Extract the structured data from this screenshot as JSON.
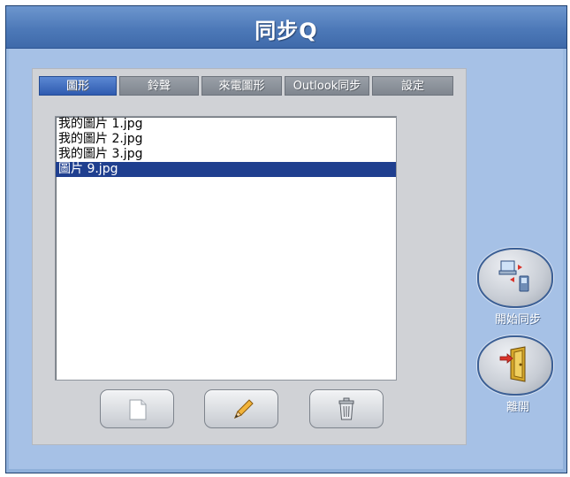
{
  "window": {
    "title": "同步Q"
  },
  "tabs": [
    {
      "label": "圖形",
      "active": true
    },
    {
      "label": "鈴聲",
      "active": false
    },
    {
      "label": "來電圖形",
      "active": false
    },
    {
      "label": "Outlook同步",
      "active": false
    },
    {
      "label": "設定",
      "active": false
    }
  ],
  "file_list": {
    "items": [
      {
        "label": "我的圖片 1.jpg",
        "selected": false
      },
      {
        "label": "我的圖片 2.jpg",
        "selected": false
      },
      {
        "label": "我的圖片 3.jpg",
        "selected": false
      },
      {
        "label": "圖片 9.jpg",
        "selected": true
      }
    ]
  },
  "actions": {
    "new_icon": "new-file-icon",
    "edit_icon": "pencil-icon",
    "delete_icon": "trash-icon"
  },
  "side": {
    "sync_label": "開始同步",
    "exit_label": "離開"
  },
  "colors": {
    "title_bar": "#4d79b8",
    "active_tab": "#2f5bb0",
    "selection": "#1f3f8f"
  }
}
